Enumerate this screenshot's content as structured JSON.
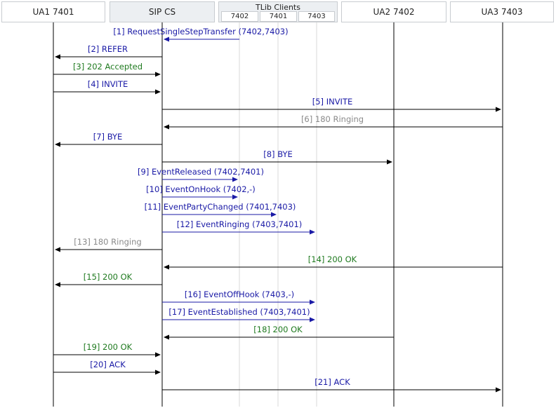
{
  "colors": {
    "request": "#1a1aa6",
    "success": "#1f7a1f",
    "provisional": "#8a8a8a",
    "tlib_arrow": "#1a1aa6",
    "sip_arrow": "#000000",
    "lifeline": "#000000",
    "client_lifeline": "#d8d8d8"
  },
  "participants": {
    "ua1": "UA1 7401",
    "sipcs": "SIP CS",
    "tlib": "TLib Clients",
    "ua2": "UA2 7402",
    "ua3": "UA3 7403"
  },
  "tlib_clients": [
    "7402",
    "7401",
    "7403"
  ],
  "messages": [
    {
      "label": "[1] RequestSingleStepTransfer (7402,7403)",
      "from": "c7402",
      "to": "sipcs",
      "kind": "request",
      "tlib": true
    },
    {
      "label": "[2] REFER",
      "from": "sipcs",
      "to": "ua1",
      "kind": "request"
    },
    {
      "label": "[3] 202 Accepted",
      "from": "ua1",
      "to": "sipcs",
      "kind": "success"
    },
    {
      "label": "[4] INVITE",
      "from": "ua1",
      "to": "sipcs",
      "kind": "request"
    },
    {
      "label": "[5] INVITE",
      "from": "sipcs",
      "to": "ua3",
      "kind": "request"
    },
    {
      "label": "[6] 180 Ringing",
      "from": "ua3",
      "to": "sipcs",
      "kind": "provisional"
    },
    {
      "label": "[7] BYE",
      "from": "sipcs",
      "to": "ua1",
      "kind": "request"
    },
    {
      "label": "[8] BYE",
      "from": "sipcs",
      "to": "ua2",
      "kind": "request"
    },
    {
      "label": "[9] EventReleased (7402,7401)",
      "from": "sipcs",
      "to": "c7402",
      "kind": "request",
      "tlib": true
    },
    {
      "label": "[10] EventOnHook (7402,-)",
      "from": "sipcs",
      "to": "c7402",
      "kind": "request",
      "tlib": true
    },
    {
      "label": "[11] EventPartyChanged (7401,7403)",
      "from": "sipcs",
      "to": "c7401",
      "kind": "request",
      "tlib": true
    },
    {
      "label": "[12] EventRinging (7403,7401)",
      "from": "sipcs",
      "to": "c7403",
      "kind": "request",
      "tlib": true
    },
    {
      "label": "[13] 180 Ringing",
      "from": "sipcs",
      "to": "ua1",
      "kind": "provisional"
    },
    {
      "label": "[14] 200 OK",
      "from": "ua3",
      "to": "sipcs",
      "kind": "success"
    },
    {
      "label": "[15] 200 OK",
      "from": "sipcs",
      "to": "ua1",
      "kind": "success"
    },
    {
      "label": "[16] EventOffHook (7403,-)",
      "from": "sipcs",
      "to": "c7403",
      "kind": "request",
      "tlib": true
    },
    {
      "label": "[17] EventEstablished (7403,7401)",
      "from": "sipcs",
      "to": "c7403",
      "kind": "request",
      "tlib": true
    },
    {
      "label": "[18] 200 OK",
      "from": "ua2",
      "to": "sipcs",
      "kind": "success"
    },
    {
      "label": "[19] 200 OK",
      "from": "ua1",
      "to": "sipcs",
      "kind": "success"
    },
    {
      "label": "[20] ACK",
      "from": "ua1",
      "to": "sipcs",
      "kind": "request"
    },
    {
      "label": "[21] ACK",
      "from": "sipcs",
      "to": "ua3",
      "kind": "request"
    }
  ]
}
